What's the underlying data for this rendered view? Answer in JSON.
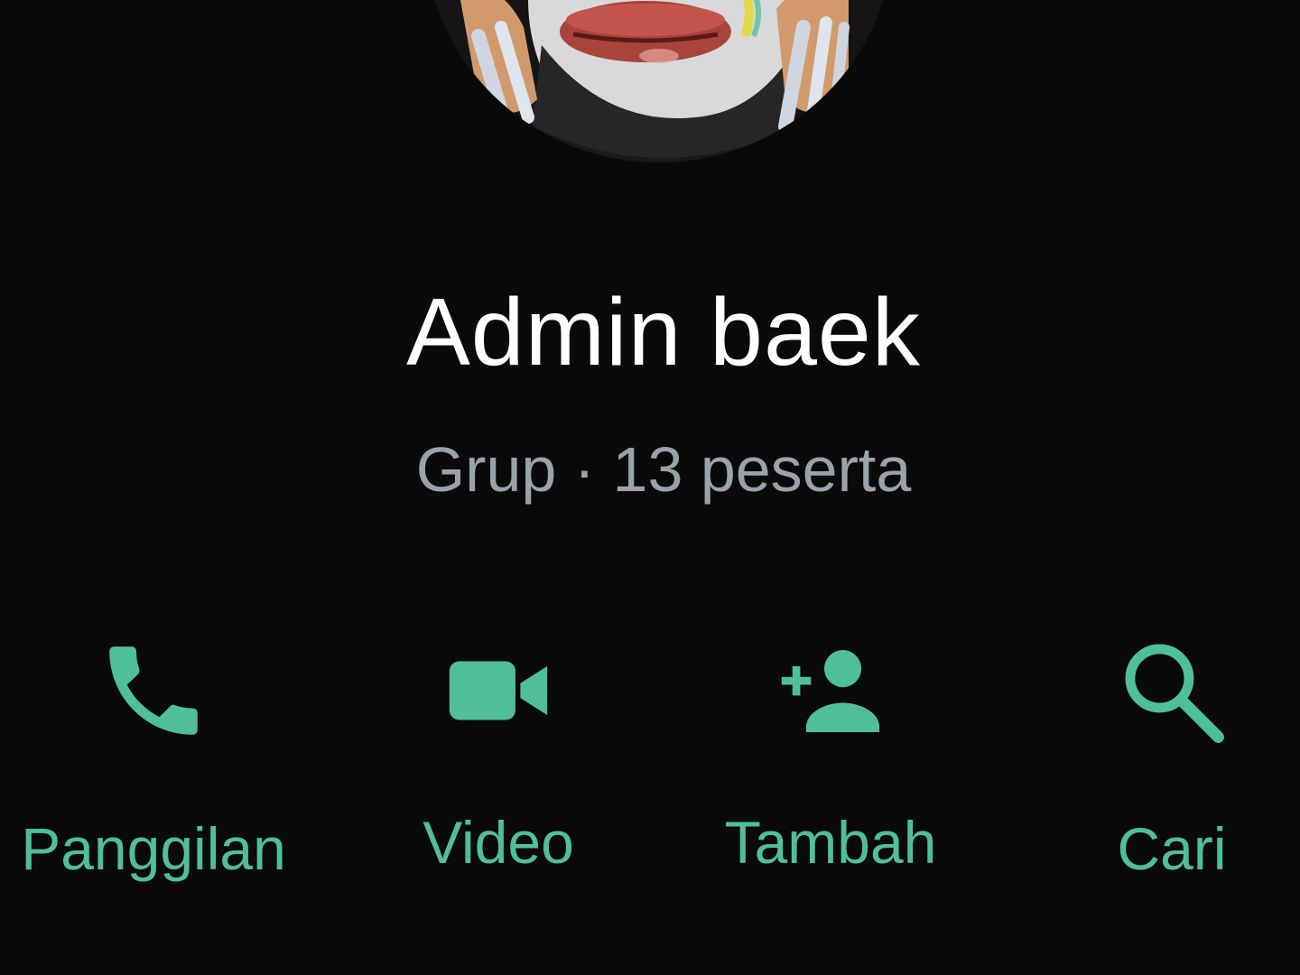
{
  "group": {
    "name": "Admin baek",
    "meta": "Grup · 13 peserta"
  },
  "avatar": {
    "icon": "group-profile-photo"
  },
  "actions": [
    {
      "label": "Panggilan",
      "icon": "phone-icon"
    },
    {
      "label": "Video",
      "icon": "video-camera-icon"
    },
    {
      "label": "Tambah",
      "icon": "add-person-icon"
    },
    {
      "label": "Cari",
      "icon": "search-icon"
    }
  ],
  "colors": {
    "background": "#0a0a0a",
    "accent": "#4fbf9a",
    "title": "#ffffff",
    "subtitle": "#9aa3a8"
  }
}
